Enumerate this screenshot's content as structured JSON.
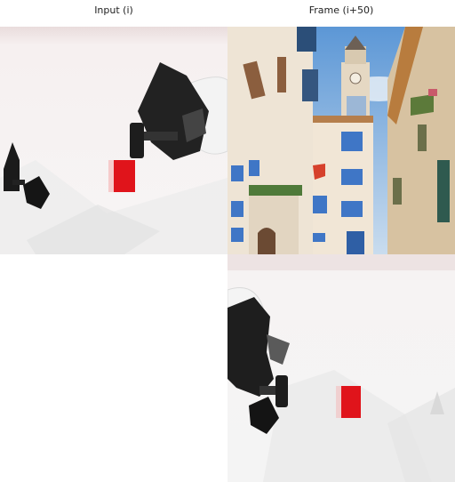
{
  "headers": {
    "input_label": "Input (i)",
    "frame_label": "Frame (i+50)"
  },
  "panels": [
    {
      "name": "input-frame-robot",
      "depicts": "robot-gripper-red-cube"
    },
    {
      "name": "output-frame-street",
      "depicts": "european-street-buildings-clock-tower"
    },
    {
      "name": "output-frame-robot",
      "depicts": "robot-gripper-red-cube"
    }
  ],
  "colors": {
    "cube": "#e0141b",
    "sky": "#7fb1dc",
    "shutter": "#3f76c6"
  }
}
